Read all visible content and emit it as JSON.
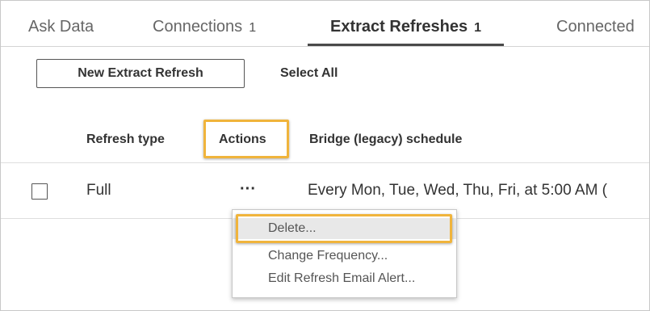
{
  "tabs": [
    {
      "label": "Ask Data",
      "count": ""
    },
    {
      "label": "Connections",
      "count": "1"
    },
    {
      "label": "Extract Refreshes",
      "count": "1"
    },
    {
      "label": "Connected",
      "count": ""
    }
  ],
  "active_tab": "Extract Refreshes",
  "toolbar": {
    "new_button_label": "New Extract Refresh",
    "select_all_label": "Select All"
  },
  "table": {
    "columns": [
      "Refresh type",
      "Actions",
      "Bridge (legacy) schedule"
    ],
    "rows": [
      {
        "checked": false,
        "refresh_type": "Full",
        "actions_icon": "···",
        "schedule": "Every Mon, Tue, Wed, Thu, Fri, at 5:00 AM ("
      }
    ]
  },
  "actions_menu": {
    "items": [
      "Delete...",
      "Change Frequency...",
      "Edit Refresh Email Alert..."
    ],
    "highlighted_index": 0
  },
  "colors": {
    "highlight": "#f0b43c",
    "active_tab_underline": "#4a4a4a"
  }
}
